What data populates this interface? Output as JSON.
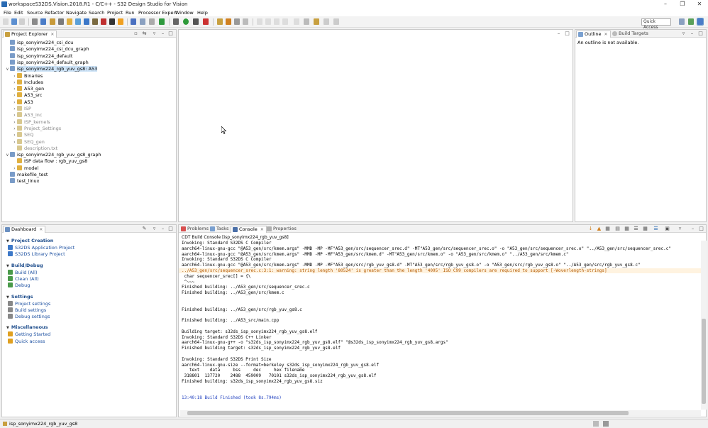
{
  "window": {
    "title": "workspaceS32DS.Vision.2018.R1 - C/C++ - S32 Design Studio for Vision"
  },
  "menu": [
    "File",
    "Edit",
    "Source",
    "Refactor",
    "Navigate",
    "Search",
    "Project",
    "Run",
    "Processor Expert",
    "Window",
    "Help"
  ],
  "toolbar": {
    "quick_access": "Quick Access"
  },
  "project_explorer": {
    "tab_label": "Project Explorer",
    "items": [
      {
        "label": "isp_sonyimx224_csi_dcu",
        "indent": 0,
        "arrow": "",
        "sel": false,
        "gray": false
      },
      {
        "label": "isp_sonyimx224_csi_dcu_graph",
        "indent": 0,
        "arrow": "",
        "sel": false,
        "gray": false
      },
      {
        "label": "isp_sonyimx224_default",
        "indent": 0,
        "arrow": "",
        "sel": false,
        "gray": false
      },
      {
        "label": "isp_sonyimx224_default_graph",
        "indent": 0,
        "arrow": "",
        "sel": false,
        "gray": false
      },
      {
        "label": "isp_sonyimx224_rgb_yuv_gs8: A53",
        "indent": 0,
        "arrow": "v",
        "sel": true,
        "gray": false
      },
      {
        "label": "Binaries",
        "indent": 1,
        "arrow": ">",
        "sel": false,
        "gray": false
      },
      {
        "label": "Includes",
        "indent": 1,
        "arrow": ">",
        "sel": false,
        "gray": false
      },
      {
        "label": "A53_gen",
        "indent": 1,
        "arrow": ">",
        "sel": false,
        "gray": false
      },
      {
        "label": "A53_src",
        "indent": 1,
        "arrow": ">",
        "sel": false,
        "gray": false
      },
      {
        "label": "A53",
        "indent": 1,
        "arrow": ">",
        "sel": false,
        "gray": false
      },
      {
        "label": "ISP",
        "indent": 1,
        "arrow": ">",
        "sel": false,
        "gray": true
      },
      {
        "label": "A53_inc",
        "indent": 1,
        "arrow": ">",
        "sel": false,
        "gray": true
      },
      {
        "label": "ISP_kernels",
        "indent": 1,
        "arrow": ">",
        "sel": false,
        "gray": true
      },
      {
        "label": "Project_Settings",
        "indent": 1,
        "arrow": ">",
        "sel": false,
        "gray": true
      },
      {
        "label": "SEQ",
        "indent": 1,
        "arrow": ">",
        "sel": false,
        "gray": true
      },
      {
        "label": "SEQ_gen",
        "indent": 1,
        "arrow": ">",
        "sel": false,
        "gray": true
      },
      {
        "label": "description.txt",
        "indent": 1,
        "arrow": "",
        "sel": false,
        "gray": true
      },
      {
        "label": "isp_sonyimx224_rgb_yuv_gs8_graph",
        "indent": 0,
        "arrow": "v",
        "sel": false,
        "gray": false
      },
      {
        "label": "ISP data flow : rgb_yuv_gs8",
        "indent": 1,
        "arrow": "",
        "sel": false,
        "gray": false
      },
      {
        "label": "model",
        "indent": 1,
        "arrow": ">",
        "sel": false,
        "gray": false
      },
      {
        "label": "makefile_test",
        "indent": 0,
        "arrow": "",
        "sel": false,
        "gray": false
      },
      {
        "label": "test_linux",
        "indent": 0,
        "arrow": "",
        "sel": false,
        "gray": false
      }
    ]
  },
  "outline": {
    "tab_outline": "Outline",
    "tab_build_targets": "Build Targets",
    "message": "An outline is not available."
  },
  "dashboard": {
    "tab_label": "Dashboard",
    "sections": [
      {
        "title": "Project Creation",
        "items": [
          "S32DS Application Project",
          "S32DS Library Project"
        ]
      },
      {
        "title": "Build/Debug",
        "items": [
          "Build  (All)",
          "Clean  (All)",
          "Debug"
        ]
      },
      {
        "title": "Settings",
        "items": [
          "Project settings",
          "Build settings",
          "Debug settings"
        ]
      },
      {
        "title": "Miscellaneous",
        "items": [
          "Getting Started",
          "Quick access"
        ]
      }
    ]
  },
  "console": {
    "tabs": [
      "Problems",
      "Tasks",
      "Console",
      "Properties"
    ],
    "header": "CDT Build Console [isp_sonyimx224_rgb_yuv_gs8]",
    "lines": [
      {
        "text": "Invoking: Standard S32DS C Compiler",
        "style": ""
      },
      {
        "text": "aarch64-linux-gnu-gcc \"@A53_gen/src/kmem.args\" -MMD -MP -MF\"A53_gen/src/sequencer_srec.d\" -MT\"A53_gen/src/sequencer_srec.o\" -o \"A53_gen/src/sequencer_srec.o\" \"../A53_gen/src/sequencer_srec.c\"",
        "style": ""
      },
      {
        "text": "aarch64-linux-gnu-gcc \"@A53_gen/src/kmem.args\" -MMD -MP -MF\"A53_gen/src/kmem.d\" -MT\"A53_gen/src/kmem.o\" -o \"A53_gen/src/kmem.o\" \"../A53_gen/src/kmem.c\"",
        "style": ""
      },
      {
        "text": "Invoking: Standard S32DS C Compiler",
        "style": ""
      },
      {
        "text": "aarch64-linux-gnu-gcc \"@A53_gen/src/kmem.args\" -MMD -MP -MF\"A53_gen/src/rgb_yuv_gs8.d\" -MT\"A53_gen/src/rgb_yuv_gs8.o\" -o \"A53_gen/src/rgb_yuv_gs8.o\" \"../A53_gen/src/rgb_yuv_gs8.c\"",
        "style": ""
      },
      {
        "text": "../A53_gen/src/sequencer_srec.c:3:1: warning: string length '80524' is greater than the length '4095' ISO C99 compilers are required to support [-Woverlength-strings]",
        "style": "warn"
      },
      {
        "text": " char sequencer_srec[] = {\\",
        "style": ""
      },
      {
        "text": " ^~~~",
        "style": ""
      },
      {
        "text": "Finished building: ../A53_gen/src/sequencer_srec.c",
        "style": ""
      },
      {
        "text": "Finished building: ../A53_gen/src/kmem.c",
        "style": ""
      },
      {
        "text": "",
        "style": ""
      },
      {
        "text": "",
        "style": ""
      },
      {
        "text": "Finished building: ../A53_gen/src/rgb_yuv_gs8.c",
        "style": ""
      },
      {
        "text": "",
        "style": ""
      },
      {
        "text": "Finished building: ../A53_src/main.cpp",
        "style": ""
      },
      {
        "text": "",
        "style": ""
      },
      {
        "text": "Building target: s32ds_isp_sonyimx224_rgb_yuv_gs8.elf",
        "style": ""
      },
      {
        "text": "Invoking: Standard S32DS C++ Linker",
        "style": ""
      },
      {
        "text": "aarch64-linux-gnu-g++ -o \"s32ds_isp_sonyimx224_rgb_yuv_gs8.elf\" \"@s32ds_isp_sonyimx224_rgb_yuv_gs8.args\"",
        "style": ""
      },
      {
        "text": "Finished building target: s32ds_isp_sonyimx224_rgb_yuv_gs8.elf",
        "style": ""
      },
      {
        "text": "",
        "style": ""
      },
      {
        "text": "Invoking: Standard S32DS Print Size",
        "style": ""
      },
      {
        "text": "aarch64-linux-gnu-size --format=berkeley s32ds_isp_sonyimx224_rgb_yuv_gs8.elf",
        "style": ""
      },
      {
        "text": "   text    data     bss     dec     hex filename",
        "style": ""
      },
      {
        "text": " 318801  137720    2488  459009   70101 s32ds_isp_sonyimx224_rgb_yuv_gs8.elf",
        "style": ""
      },
      {
        "text": "Finished building: s32ds_isp_sonyimx224_rgb_yuv_gs8.siz",
        "style": ""
      },
      {
        "text": "",
        "style": ""
      },
      {
        "text": "",
        "style": ""
      },
      {
        "text": "13:40:18 Build Finished (took 8s.794ms)",
        "style": "blue"
      }
    ]
  },
  "status": {
    "text": "isp_sonyimx224_rgb_yuv_gs8"
  }
}
